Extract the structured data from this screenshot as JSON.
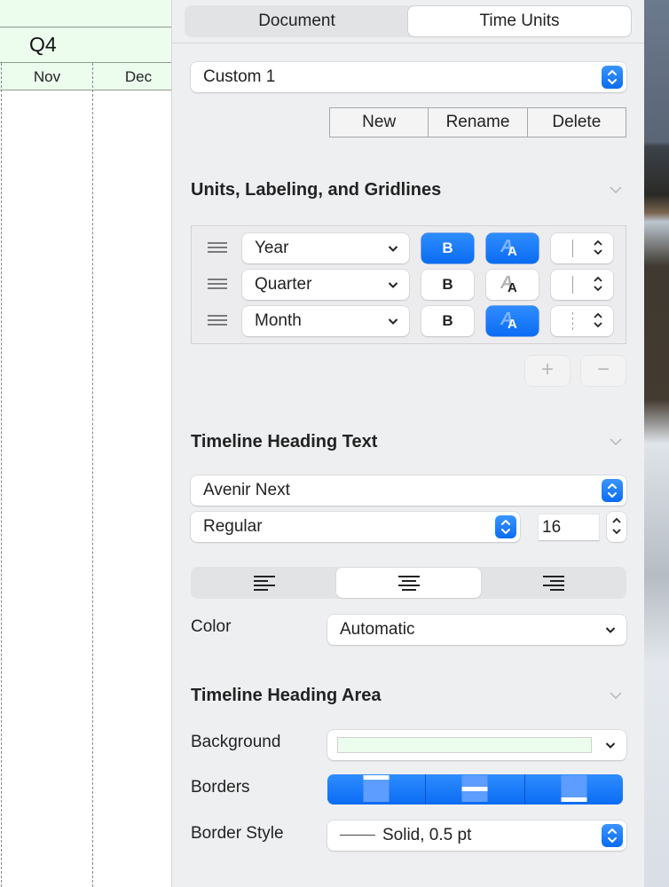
{
  "canvas": {
    "quarter_label": "Q4",
    "months": [
      "Nov",
      "Dec"
    ],
    "heading_background": "#ecfdee"
  },
  "inspector": {
    "tabs": [
      {
        "label": "Document",
        "active": false
      },
      {
        "label": "Time Units",
        "active": true
      }
    ],
    "preset": {
      "value": "Custom 1",
      "buttons": {
        "new": "New",
        "rename": "Rename",
        "delete": "Delete"
      }
    },
    "units_section": {
      "title": "Units, Labeling, and Gridlines",
      "rows": [
        {
          "unit": "Year",
          "bold": true,
          "fill_color": true,
          "gridline": "solid"
        },
        {
          "unit": "Quarter",
          "bold": false,
          "fill_color": false,
          "gridline": "solid"
        },
        {
          "unit": "Month",
          "bold": false,
          "fill_color": true,
          "gridline": "dashed"
        }
      ],
      "bold_glyph": "B",
      "aa_glyph_back": "A",
      "aa_glyph_front": "A",
      "add_label": "+",
      "remove_label": "−"
    },
    "heading_text": {
      "title": "Timeline Heading Text",
      "font": "Avenir Next",
      "style": "Regular",
      "size": "16",
      "alignment_options": [
        "left",
        "center",
        "right"
      ],
      "alignment_selected": "center",
      "color_label": "Color",
      "color_value": "Automatic"
    },
    "heading_area": {
      "title": "Timeline Heading Area",
      "background_label": "Background",
      "background_color": "#ecfdee",
      "borders_label": "Borders",
      "borders_options": [
        "top",
        "middle",
        "bottom"
      ],
      "borders_selected": [
        "top",
        "middle",
        "bottom"
      ],
      "border_style_label": "Border Style",
      "border_style_value": "Solid, 0.5 pt"
    }
  },
  "colors": {
    "accent": "#0a6cf3",
    "panel_bg": "#eeeff1"
  }
}
